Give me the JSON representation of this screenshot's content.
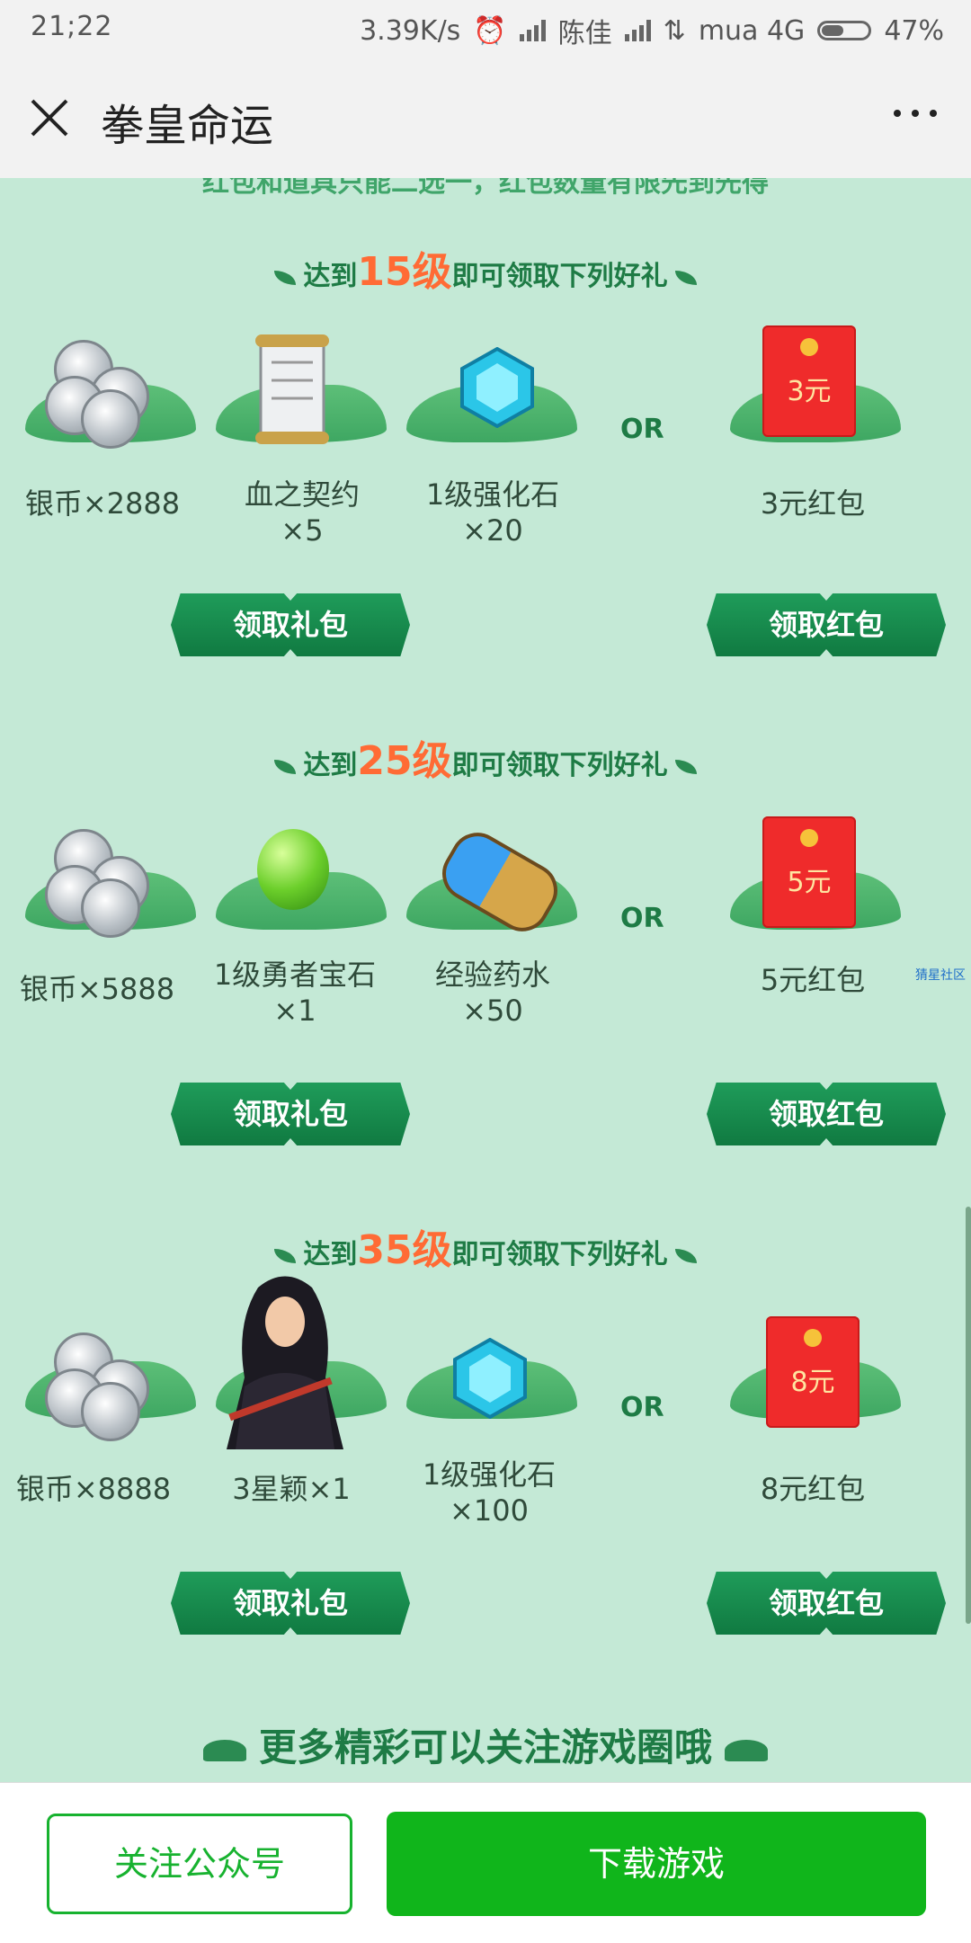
{
  "status": {
    "time": "21;22",
    "speed": "3.39K/s",
    "carrier1": "陈佳",
    "carrier2": "mua 4G",
    "battery": "47%"
  },
  "nav": {
    "title": "拳皇命运"
  },
  "notice": "红包和道具只能二选一，红包数量有限先到先得",
  "tiers": [
    {
      "head_prefix": "达到",
      "level": "15级",
      "head_suffix": "即可领取下列好礼",
      "items": [
        "银币×2888",
        "血之契约\n×5",
        "1级强化石\n×20"
      ],
      "redpack_amount": "3元",
      "redpack_label": "3元红包"
    },
    {
      "head_prefix": "达到",
      "level": "25级",
      "head_suffix": "即可领取下列好礼",
      "items": [
        "银币×5888",
        "1级勇者宝石\n×1",
        "经验药水\n×50"
      ],
      "redpack_amount": "5元",
      "redpack_label": "5元红包"
    },
    {
      "head_prefix": "达到",
      "level": "35级",
      "head_suffix": "即可领取下列好礼",
      "items": [
        "银币×8888",
        "3星颖×1",
        "1级强化石\n×100"
      ],
      "redpack_amount": "8元",
      "redpack_label": "8元红包"
    }
  ],
  "or_text": "OR",
  "btn_gift": "领取礼包",
  "btn_redpack": "领取红包",
  "side_tag": "猜星社区",
  "footer_promo": "更多精彩可以关注游戏圈哦",
  "bottom": {
    "follow": "关注公众号",
    "download": "下载游戏"
  },
  "colors": {
    "page_bg": "#c4e9d6",
    "brand_green": "#10b51b",
    "accent_orange": "#ff6b35",
    "red_packet": "#ef2b2b"
  }
}
